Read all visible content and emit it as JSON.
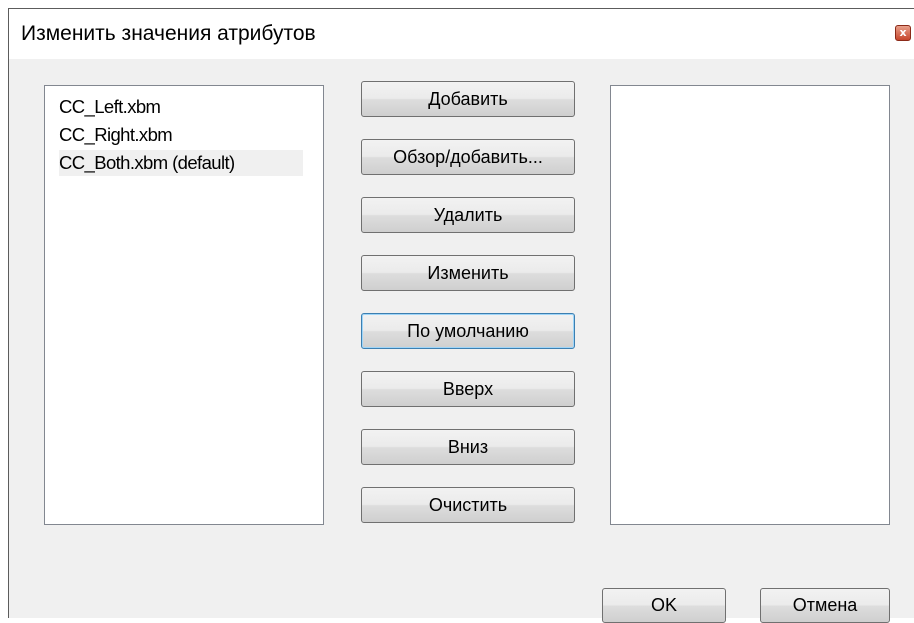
{
  "window": {
    "title": "Изменить значения атрибутов",
    "close_glyph": "x"
  },
  "value_list": {
    "items": [
      {
        "label": "CC_Left.xbm"
      },
      {
        "label": "CC_Right.xbm"
      },
      {
        "label": "CC_Both.xbm (default)",
        "selected": true
      }
    ]
  },
  "actions": {
    "add": "Добавить",
    "browse_add": "Обзор/добавить...",
    "delete": "Удалить",
    "edit": "Изменить",
    "default": "По умолчанию",
    "up": "Вверх",
    "down": "Вниз",
    "clear": "Очистить"
  },
  "footer": {
    "ok": "OK",
    "cancel": "Отмена"
  },
  "colors": {
    "dialog_bg": "#f0f0f0",
    "titlebar_bg": "#ffffff",
    "focus_border": "#3c7fb1",
    "close_red": "#c6452b"
  }
}
